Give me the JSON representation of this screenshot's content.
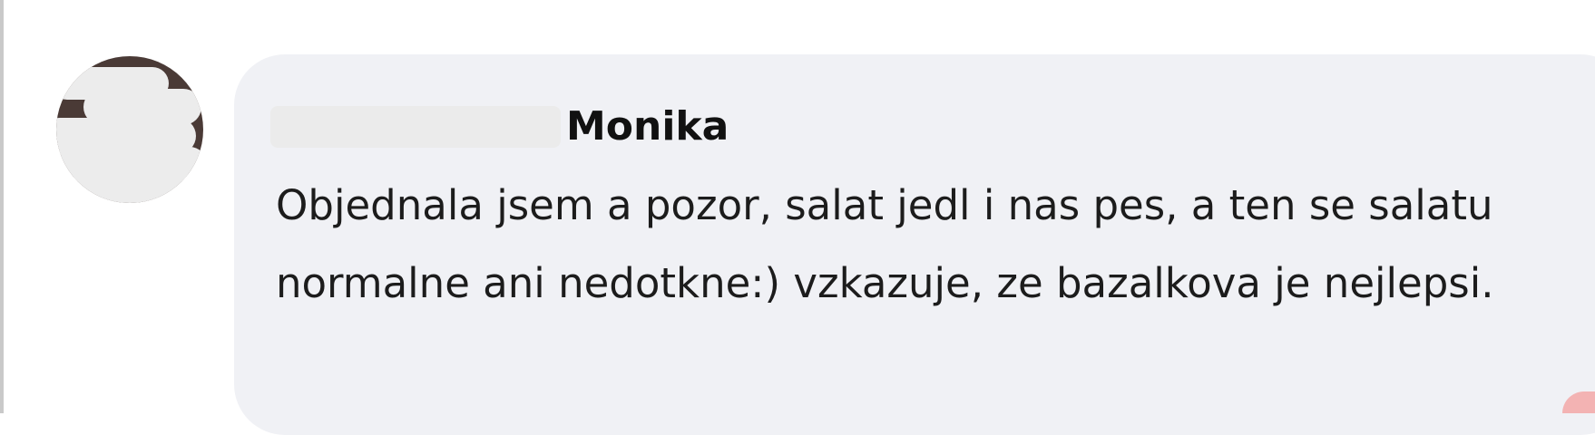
{
  "comment": {
    "author_visible": "Monika",
    "text": "Objednala jsem a pozor, salat jedl i nas pes, a ten se salatu normalne ani nedotkne:) vzkazuje, ze bazalkova je nejlepsi."
  },
  "colors": {
    "bubble_background": "#f0f1f5",
    "text": "#1c1c1c",
    "name": "#111111",
    "redaction": "#ebebeb"
  }
}
